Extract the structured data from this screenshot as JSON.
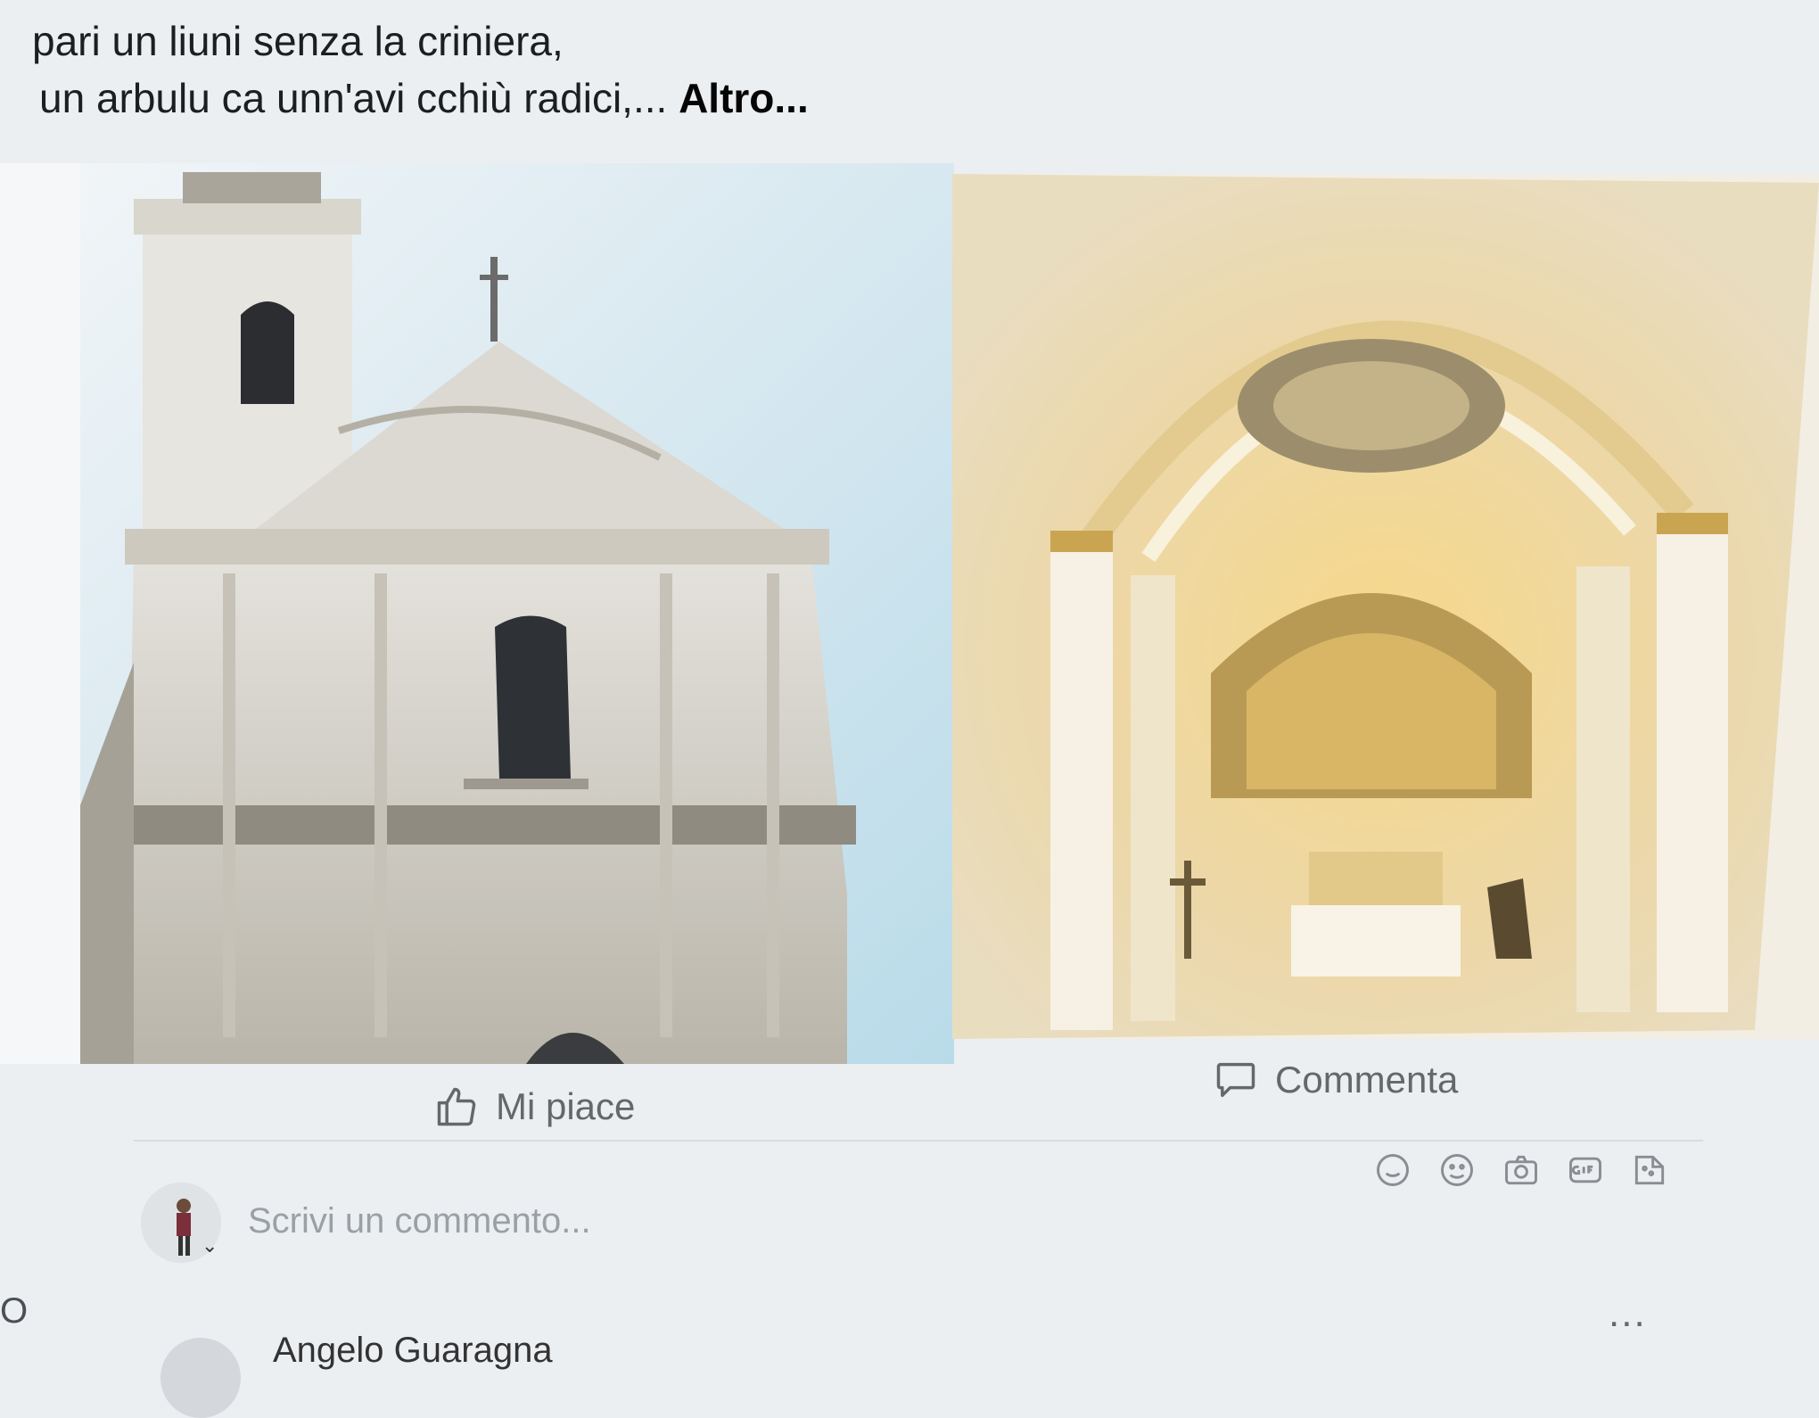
{
  "post": {
    "text_line1": "pari un liuni senza la criniera,",
    "text_line2": "un arbulu ca unn'avi cchiù radici,...",
    "more_label": "Altro..."
  },
  "photos": [
    {
      "name": "church-exterior",
      "icon": "photo-church-facade"
    },
    {
      "name": "church-interior",
      "icon": "photo-church-nave"
    }
  ],
  "actions": {
    "like_label": "Mi piace",
    "comment_label": "Commenta"
  },
  "comment_box": {
    "placeholder": "Scrivi un commento...",
    "tools": [
      "sticker-icon",
      "emoji-icon",
      "camera-icon",
      "gif-icon",
      "stickers-icon"
    ]
  },
  "next_comment": {
    "author": "Angelo Guaragna",
    "left_edge_char": "O",
    "more_label": "..."
  },
  "colors": {
    "background": "#eceff1",
    "action_text": "#65676b",
    "placeholder": "#9aa0a6"
  }
}
